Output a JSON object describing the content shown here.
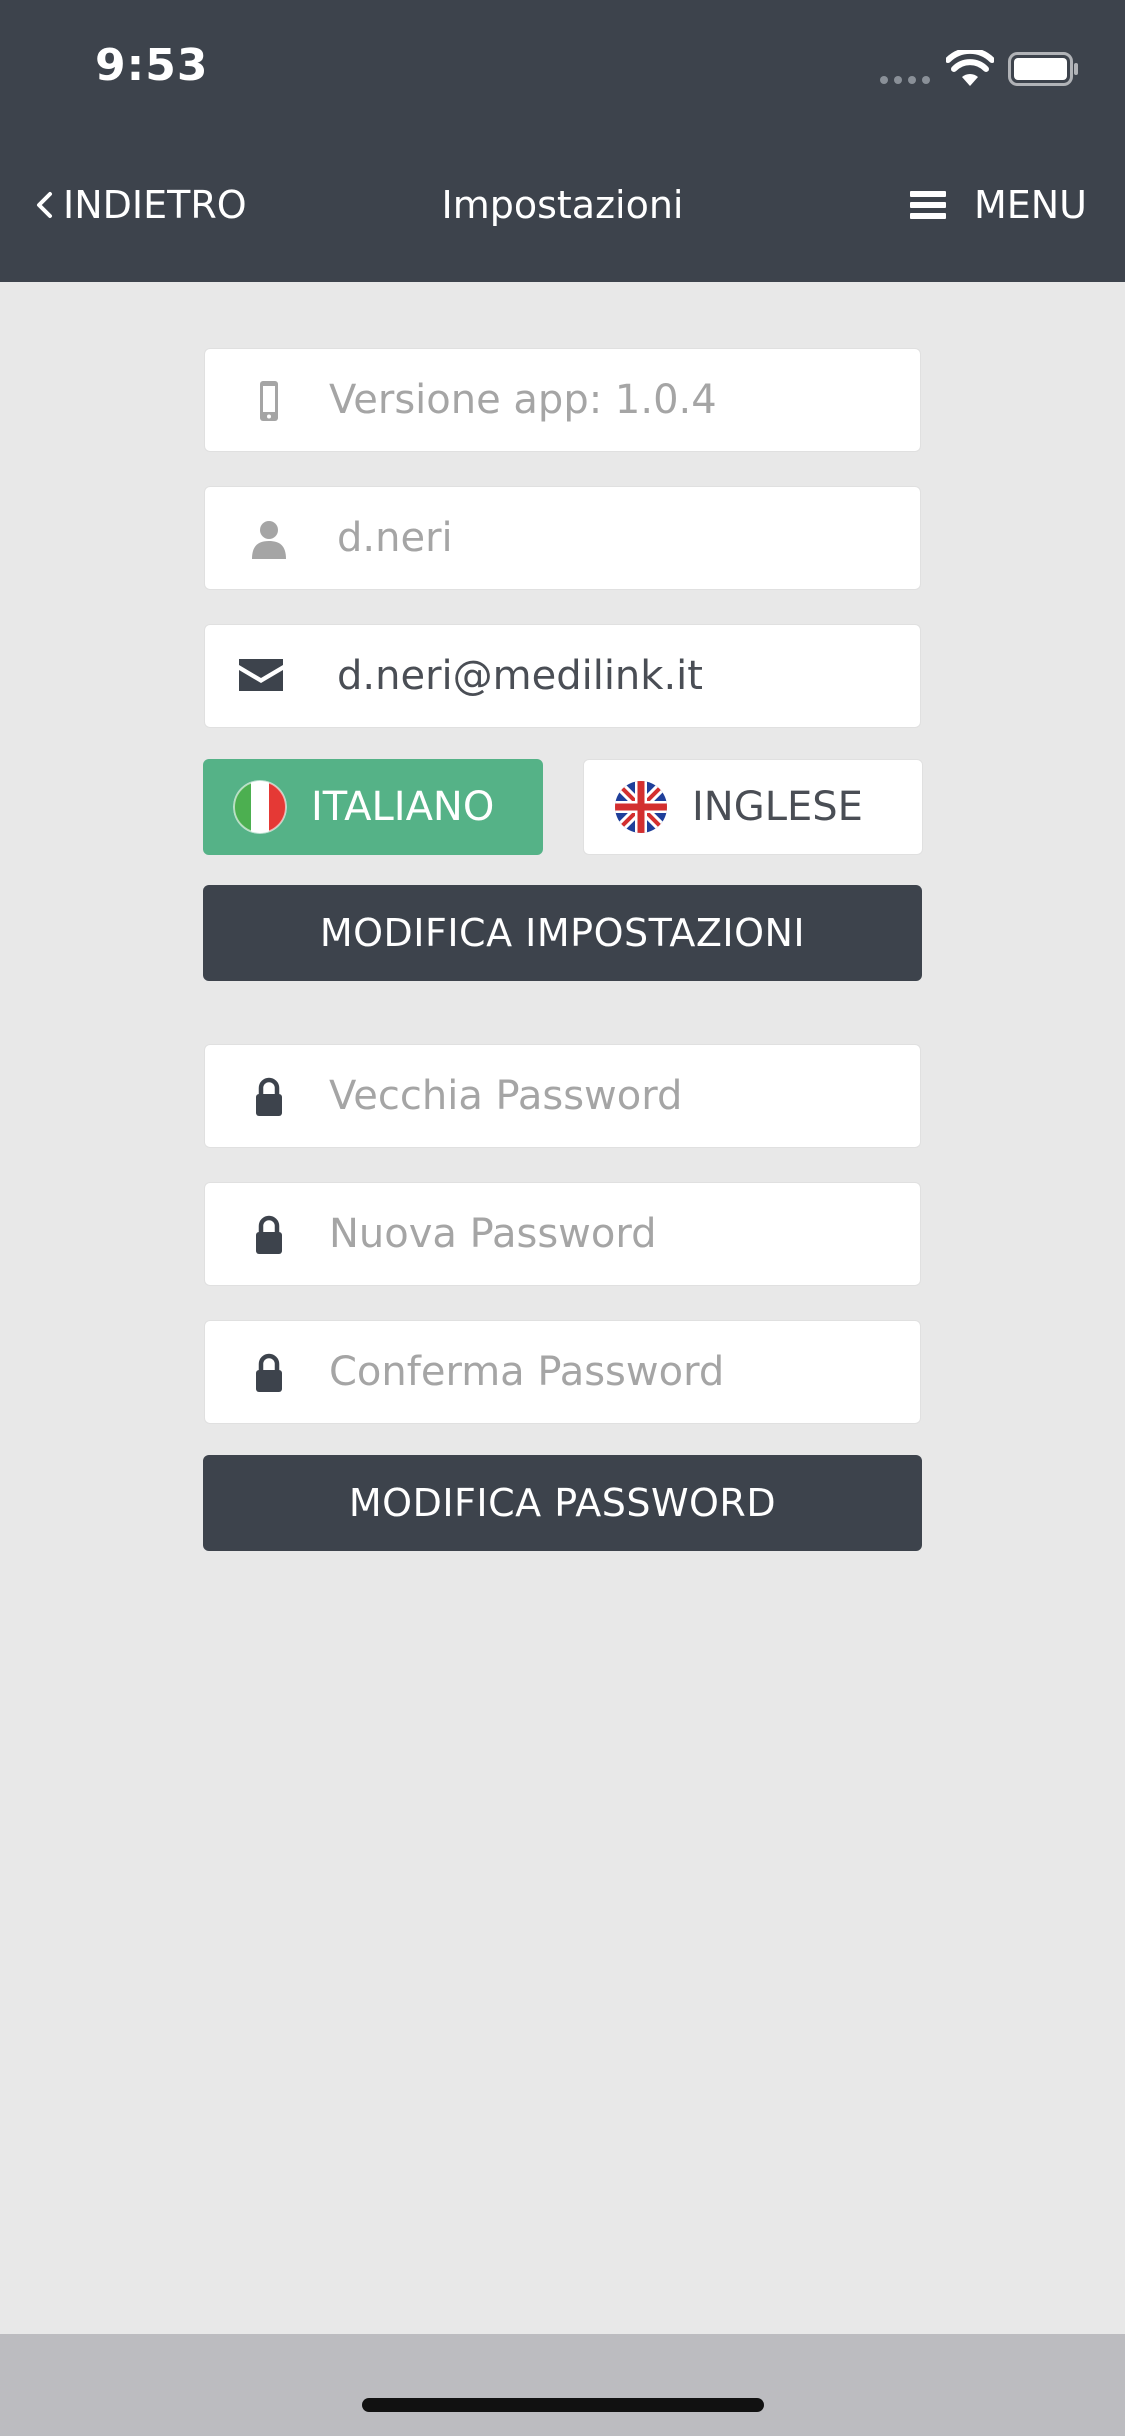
{
  "status_bar": {
    "time": "9:53"
  },
  "nav": {
    "back_label": "INDIETRO",
    "title": "Impostazioni",
    "menu_label": "MENU"
  },
  "settings": {
    "app_version": "Versione app: 1.0.4",
    "username": "d.neri",
    "email": "d.neri@medilink.it",
    "language_italian": "ITALIANO",
    "language_english": "INGLESE",
    "selected_language": "ITALIANO",
    "save_settings_label": "MODIFICA IMPOSTAZIONI"
  },
  "password": {
    "old_placeholder": "Vecchia Password",
    "new_placeholder": "Nuova Password",
    "confirm_placeholder": "Conferma Password",
    "save_password_label": "MODIFICA PASSWORD"
  },
  "colors": {
    "header_bg": "#3d434c",
    "page_bg": "#e8e8e8",
    "accent_green": "#55b287",
    "icon_gray": "#a5a5a5",
    "icon_dark": "#3d434c"
  },
  "icons": {
    "version": "mobile-phone-icon",
    "username": "user-icon",
    "email": "envelope-icon",
    "password": "lock-icon",
    "back": "chevron-left-icon",
    "menu": "hamburger-icon"
  }
}
